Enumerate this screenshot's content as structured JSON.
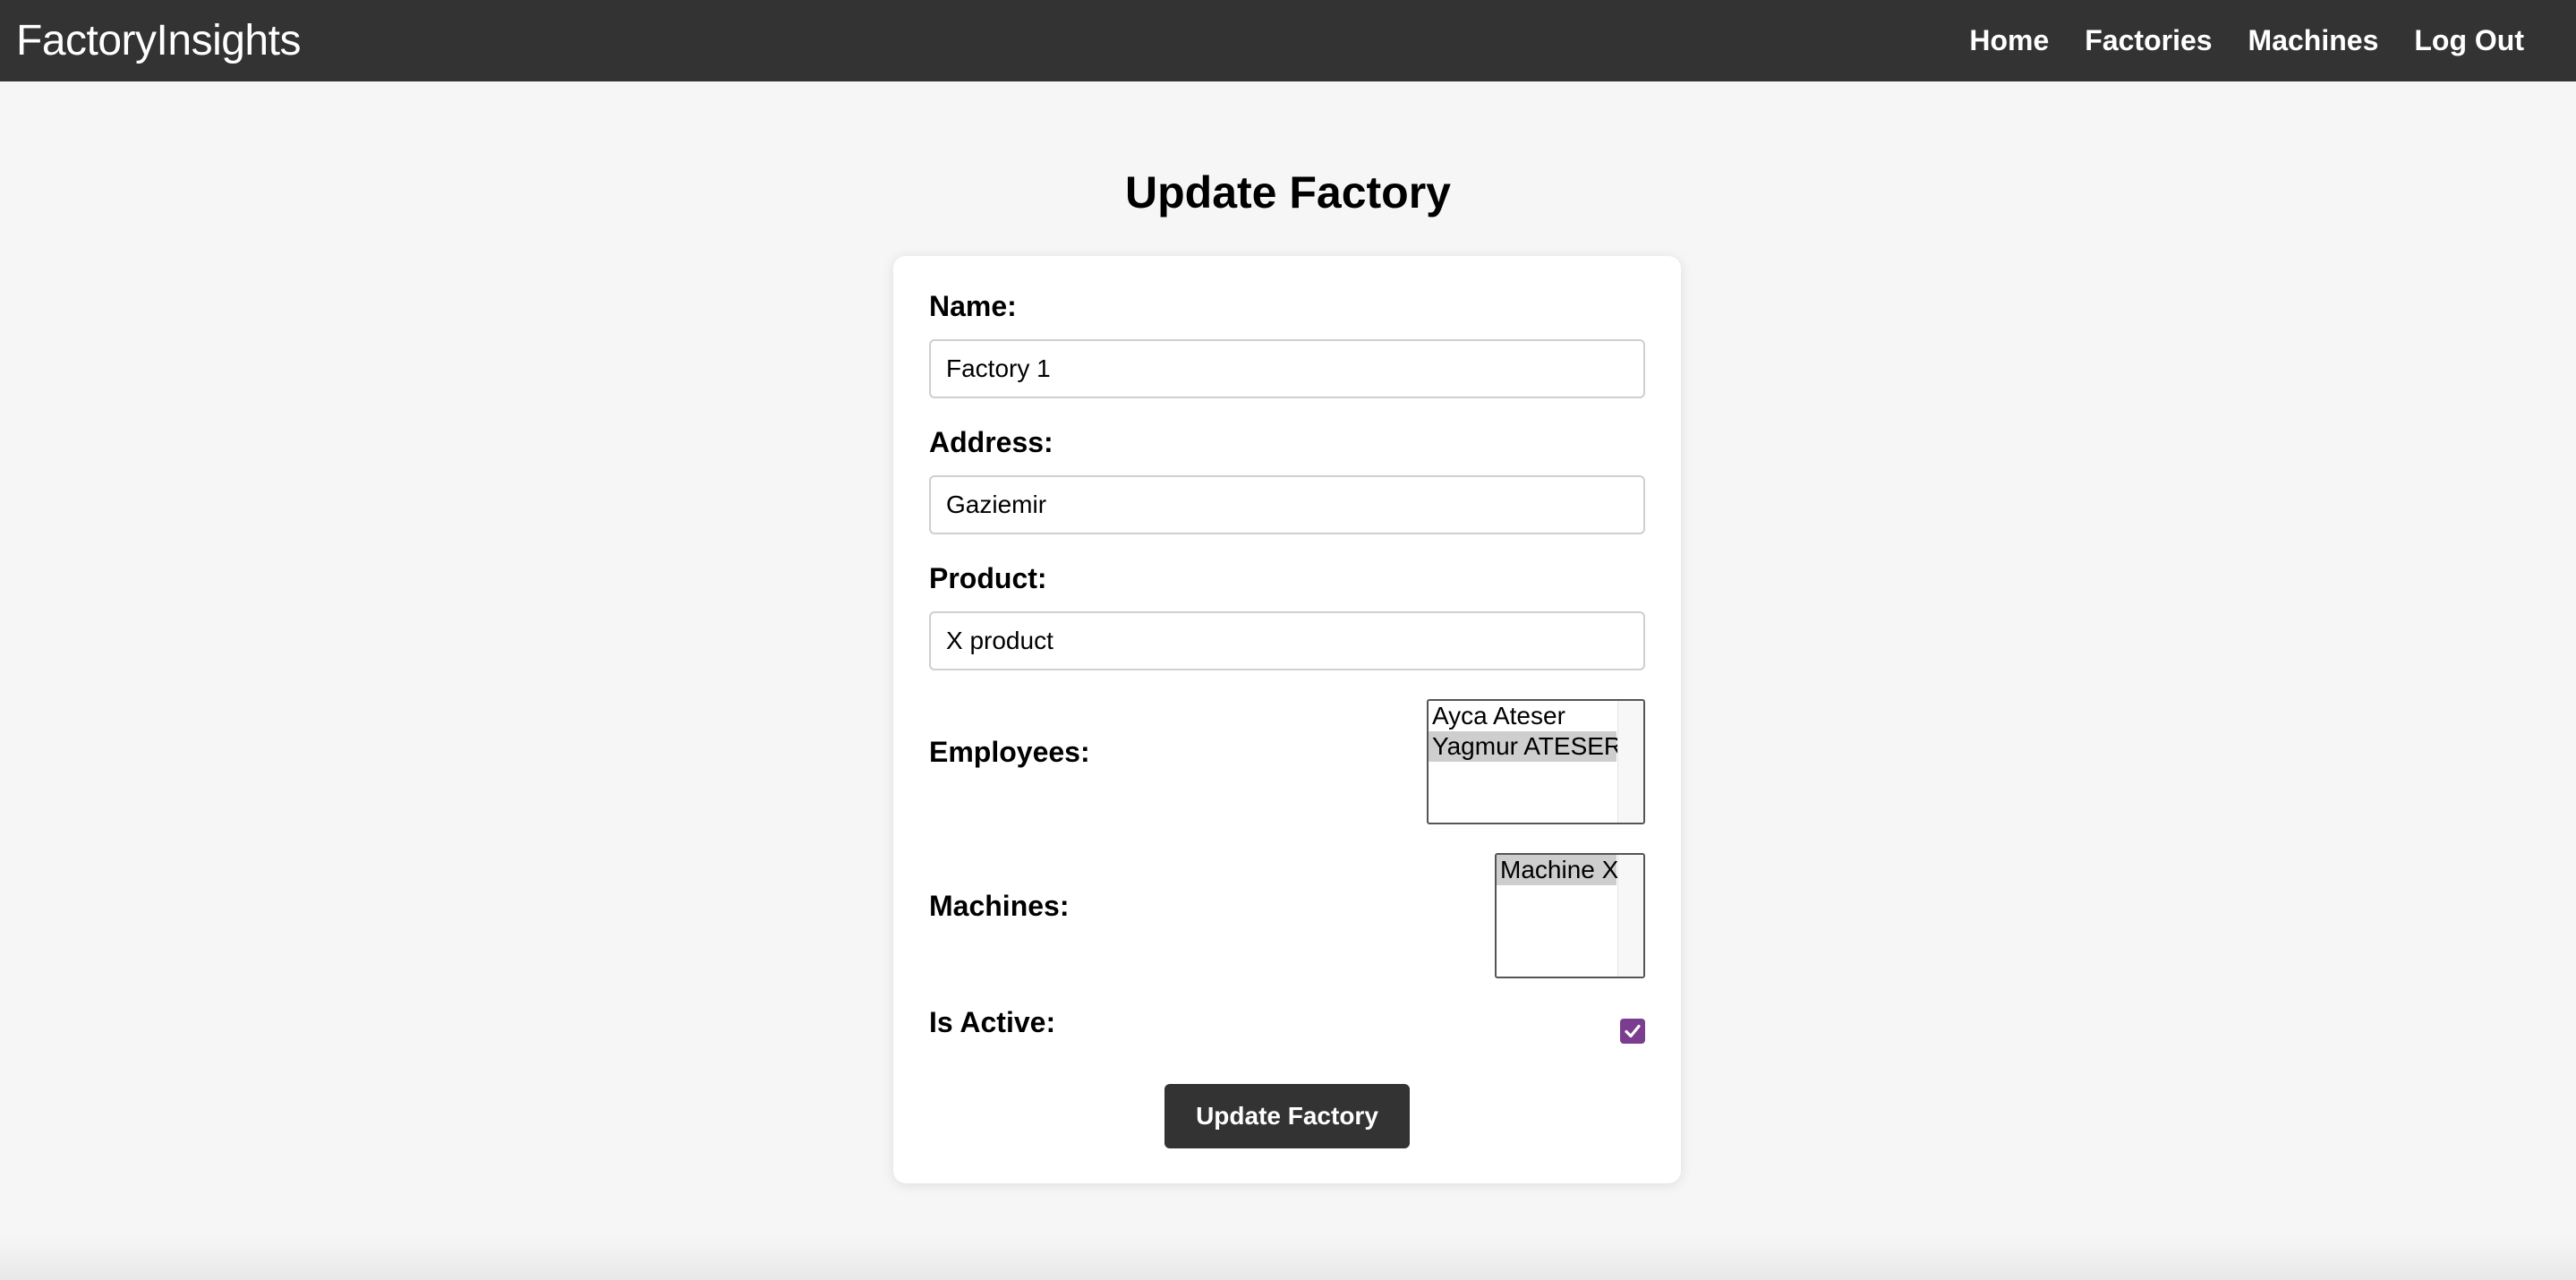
{
  "app": {
    "brand": "FactoryInsights"
  },
  "nav": {
    "items": [
      {
        "label": "Home"
      },
      {
        "label": "Factories"
      },
      {
        "label": "Machines"
      },
      {
        "label": "Log Out"
      }
    ]
  },
  "page": {
    "title": "Update Factory"
  },
  "form": {
    "name": {
      "label": "Name:",
      "value": "Factory 1"
    },
    "address": {
      "label": "Address:",
      "value": "Gaziemir"
    },
    "product": {
      "label": "Product:",
      "value": "X product"
    },
    "employees": {
      "label": "Employees:",
      "options": [
        {
          "text": "Ayca Ateser",
          "selected": false
        },
        {
          "text": "Yagmur ATESER",
          "selected": true
        }
      ]
    },
    "machines": {
      "label": "Machines:",
      "options": [
        {
          "text": "Machine X",
          "selected": true
        }
      ]
    },
    "is_active": {
      "label": "Is Active:",
      "checked": true
    },
    "submit_label": "Update Factory"
  },
  "colors": {
    "navbar": "#333333",
    "page_bg": "#f6f6f6",
    "checkbox_accent": "#7a3d8f",
    "button_bg": "#333333",
    "selected_option": "#cecece"
  }
}
